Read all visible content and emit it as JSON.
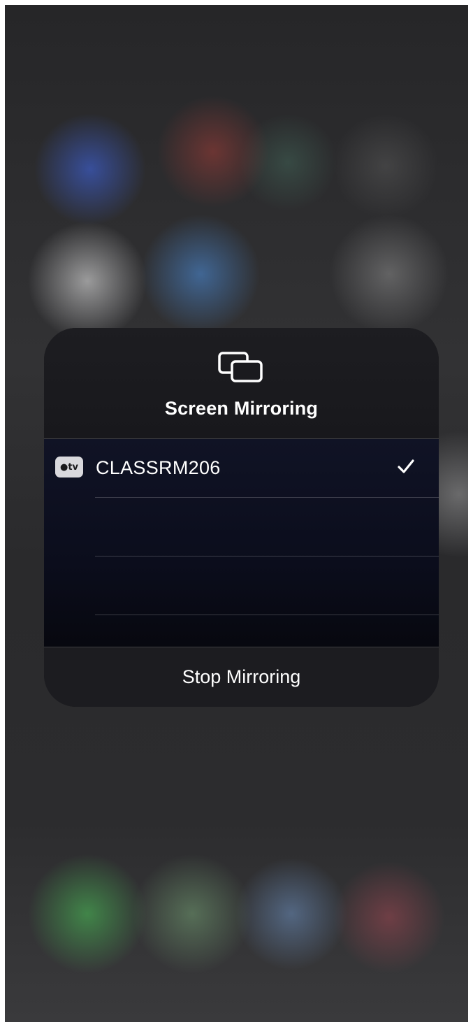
{
  "panel": {
    "title": "Screen Mirroring",
    "icon": "screen-mirroring-icon"
  },
  "devices": [
    {
      "badge": "tv",
      "badge_icon": "apple-logo-icon",
      "name": "CLASSRM206",
      "selected": true,
      "status_icon": "checkmark-icon"
    }
  ],
  "empty_rows": 2,
  "actions": {
    "stop_label": "Stop Mirroring"
  },
  "colors": {
    "panel_bg": "#18181c",
    "list_bg": "#0b0d1c",
    "text": "#ffffff",
    "badge_bg": "#d9d9dd"
  }
}
